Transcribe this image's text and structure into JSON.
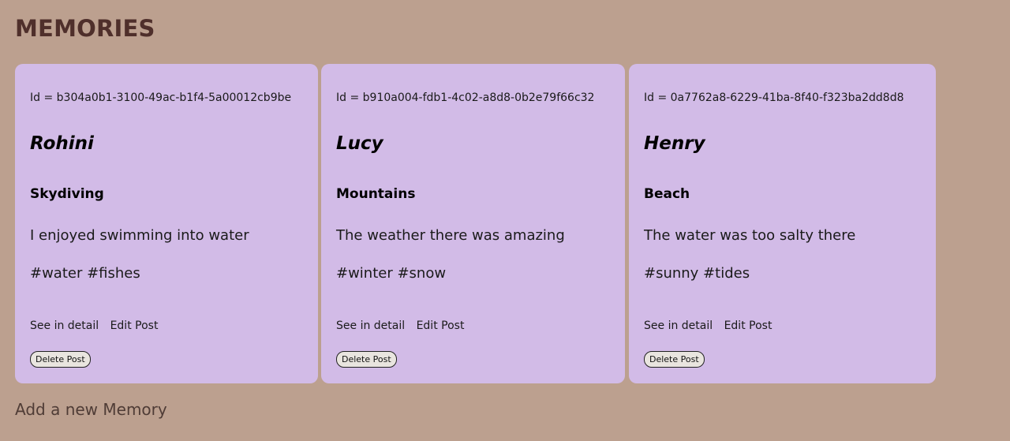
{
  "page": {
    "title": "MEMORIES",
    "add_link": "Add a new Memory"
  },
  "cards": [
    {
      "id_text": "Id = b304a0b1-3100-49ac-b1f4-5a00012cb9be",
      "author": "Rohini",
      "title": "Skydiving",
      "message": "I enjoyed swimming into water",
      "tags": "#water #fishes",
      "see_detail": "See in detail",
      "edit": "Edit Post",
      "delete": "Delete Post"
    },
    {
      "id_text": "Id = b910a004-fdb1-4c02-a8d8-0b2e79f66c32",
      "author": "Lucy",
      "title": "Mountains",
      "message": "The weather there was amazing",
      "tags": "#winter #snow",
      "see_detail": "See in detail",
      "edit": "Edit Post",
      "delete": "Delete Post"
    },
    {
      "id_text": "Id = 0a7762a8-6229-41ba-8f40-f323ba2dd8d8",
      "author": "Henry",
      "title": "Beach",
      "message": "The water was too salty there",
      "tags": "#sunny #tides",
      "see_detail": "See in detail",
      "edit": "Edit Post",
      "delete": "Delete Post"
    }
  ],
  "colors": {
    "background": "#bca08f",
    "card": "#d2bbe7",
    "heading": "#4f2f2b"
  }
}
